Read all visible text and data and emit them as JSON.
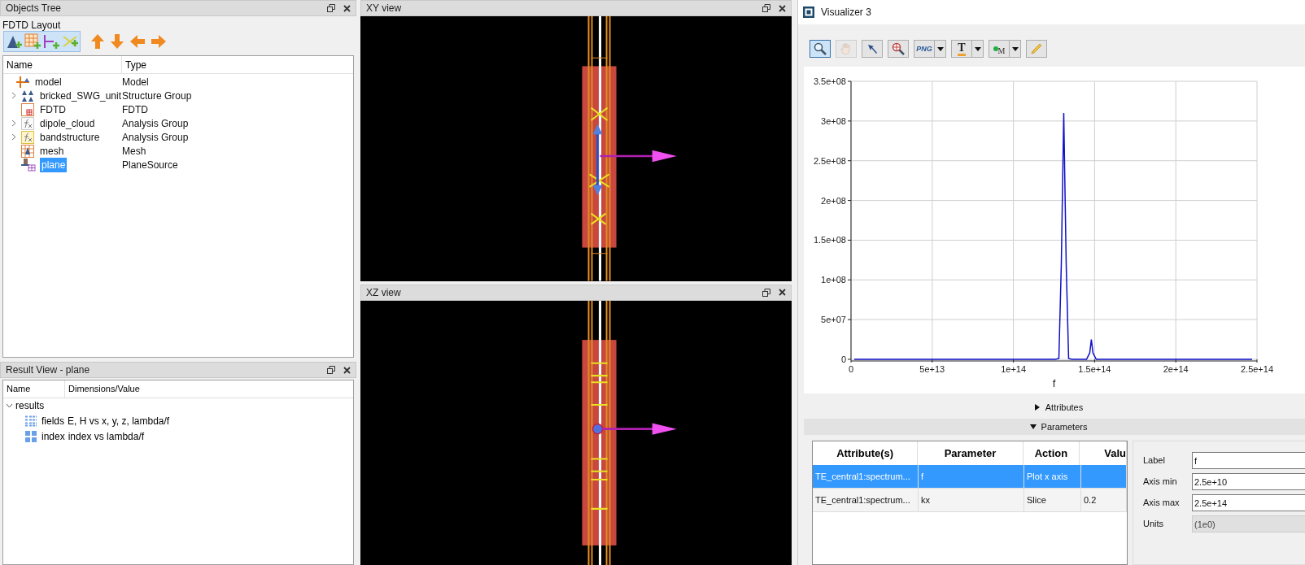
{
  "objects_tree": {
    "title": "Objects Tree",
    "layout_label": "FDTD Layout",
    "toolbar": [
      {
        "kind": "add_structure"
      },
      {
        "kind": "add_mesh"
      },
      {
        "kind": "add_monitor"
      },
      {
        "kind": "add_source"
      },
      {
        "kind": "up"
      },
      {
        "kind": "down"
      },
      {
        "kind": "left"
      },
      {
        "kind": "right"
      }
    ],
    "columns": [
      "Name",
      "Type"
    ],
    "items": [
      {
        "kind": "model",
        "name": "model",
        "type": "Model",
        "collapsed": false,
        "selected": false,
        "children": [
          {
            "kind": "structure_group",
            "name": "bricked_SWG_unit",
            "type": "Structure Group",
            "collapsed": true,
            "selected": false
          },
          {
            "kind": "fdtd",
            "name": "FDTD",
            "type": "FDTD",
            "collapsed": false,
            "selected": false
          },
          {
            "kind": "analysis_gray",
            "name": "dipole_cloud",
            "type": "Analysis Group",
            "collapsed": true,
            "selected": false
          },
          {
            "kind": "analysis",
            "name": "bandstructure",
            "type": "Analysis Group",
            "collapsed": true,
            "selected": false
          },
          {
            "kind": "mesh",
            "name": "mesh",
            "type": "Mesh",
            "collapsed": false,
            "selected": false
          },
          {
            "kind": "source",
            "name": "plane",
            "type": "PlaneSource",
            "collapsed": false,
            "selected": true
          }
        ]
      }
    ]
  },
  "result_view": {
    "title": "Result View - plane",
    "columns": [
      "Name",
      "Dimensions/Value"
    ],
    "items": [
      {
        "name": "results",
        "expanded": true,
        "children": [
          {
            "kind": "dataset",
            "name": "fields",
            "value": "E, H vs x, y, z, lambda/f"
          },
          {
            "kind": "matrix",
            "name": "index",
            "value": "index vs lambda/f"
          }
        ]
      }
    ]
  },
  "views": [
    {
      "title": "XY view",
      "kind": "xy"
    },
    {
      "title": "XZ view",
      "kind": "xz"
    }
  ],
  "visualizer": {
    "title": "Visualizer 3",
    "tools": [
      {
        "kind": "zoom",
        "selected": true,
        "disabled": false
      },
      {
        "kind": "pan",
        "selected": false,
        "disabled": true
      },
      {
        "kind": "pointer",
        "selected": false,
        "disabled": false
      },
      {
        "kind": "zoom_target",
        "selected": false,
        "disabled": false
      },
      {
        "kind": "png",
        "label": "PNG",
        "selected": false,
        "disabled": false
      },
      {
        "kind": "text",
        "label": "T",
        "selected": false,
        "disabled": false
      },
      {
        "kind": "marker",
        "label": "M",
        "selected": false,
        "disabled": false
      },
      {
        "kind": "pencil",
        "selected": false,
        "disabled": false
      }
    ],
    "chart_data": {
      "type": "line",
      "grid": true,
      "xlabel": "f",
      "xlim": [
        0,
        250000000000000.0
      ],
      "ylim": [
        0,
        350000000.0
      ],
      "xticks": [
        {
          "value": 0,
          "label": "0"
        },
        {
          "value": 50000000000000.0,
          "label": "5e+13"
        },
        {
          "value": 100000000000000.0,
          "label": "1e+14"
        },
        {
          "value": 150000000000000.0,
          "label": "1.5e+14"
        },
        {
          "value": 200000000000000.0,
          "label": "2e+14"
        },
        {
          "value": 250000000000000.0,
          "label": "2.5e+14"
        }
      ],
      "yticks": [
        {
          "value": 0,
          "label": "0"
        },
        {
          "value": 50000000.0,
          "label": "5e+07"
        },
        {
          "value": 100000000.0,
          "label": "1e+08"
        },
        {
          "value": 150000000.0,
          "label": "1.5e+08"
        },
        {
          "value": 200000000.0,
          "label": "2e+08"
        },
        {
          "value": 250000000.0,
          "label": "2.5e+08"
        },
        {
          "value": 300000000.0,
          "label": "3e+08"
        },
        {
          "value": 350000000.0,
          "label": "3.5e+08"
        }
      ],
      "x": [
        2000000000000.0,
        126000000000000.0,
        128000000000000.0,
        129500000000000.0,
        131000000000000.0,
        132500000000000.0,
        134000000000000.0,
        136000000000000.0,
        145000000000000.0,
        147000000000000.0,
        148000000000000.0,
        149000000000000.0,
        151000000000000.0,
        247000000000000.0
      ],
      "series": [
        {
          "color": "#1010c8",
          "values": [
            0,
            0,
            1000000.0,
            120000000.0,
            310000000.0,
            120000000.0,
            1000000.0,
            0,
            0,
            8000000.0,
            25000000.0,
            8000000.0,
            0,
            0
          ]
        }
      ]
    },
    "sections": [
      {
        "label": "Attributes",
        "expanded": false
      },
      {
        "label": "Parameters",
        "expanded": true
      }
    ],
    "parameters": {
      "columns": [
        "Attribute(s)",
        "Parameter",
        "Action",
        "Valu"
      ],
      "rows": [
        {
          "cells": [
            "TE_central1:spectrum...",
            "f",
            "Plot x axis",
            ""
          ],
          "selected": true
        },
        {
          "cells": [
            "TE_central1:spectrum...",
            "kx",
            "Slice",
            "0.2"
          ],
          "selected": false
        }
      ]
    },
    "axis_form": [
      {
        "label": "Label",
        "value": "f",
        "disabled": false
      },
      {
        "label": "Axis min",
        "value": "2.5e+10",
        "disabled": false
      },
      {
        "label": "Axis max",
        "value": "2.5e+14",
        "disabled": false
      },
      {
        "label": "Units",
        "value": "(1e0)",
        "disabled": true
      }
    ]
  }
}
